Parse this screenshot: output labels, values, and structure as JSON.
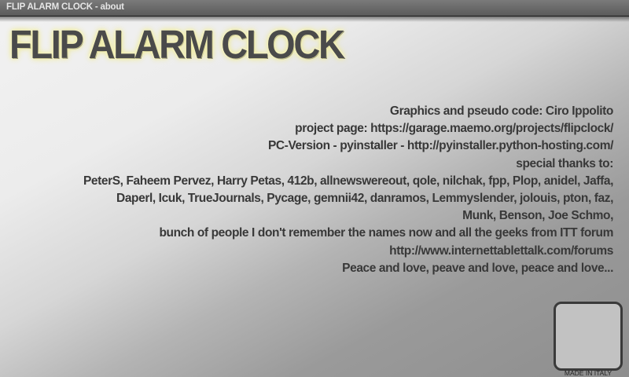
{
  "window": {
    "title": "FLIP ALARM CLOCK - about"
  },
  "header": {
    "app_title": "FLIP ALARM CLOCK"
  },
  "credits": {
    "lines": [
      "Graphics and pseudo code: Ciro Ippolito",
      "project page: https://garage.maemo.org/projects/flipclock/",
      "PC-Version  - pyinstaller - http://pyinstaller.python-hosting.com/",
      "special thanks to:",
      "PeterS, Faheem Pervez, Harry Petas, 412b, allnewswereout, qole, nilchak, fpp, Plop, anidel,  Jaffa,",
      "Daperl, Icuk, TrueJournals, Pycage, gemnii42, danramos,  Lemmyslender, jolouis, pton, faz,",
      "Munk, Benson, Joe Schmo,",
      "bunch of people I don't remember the names now and all the geeks from ITT forum",
      "http://www.internettablettalk.com/forums",
      "Peace and love, peave and love, peace and love..."
    ]
  },
  "footer": {
    "stamp_label": "MADE IN ITALY"
  }
}
